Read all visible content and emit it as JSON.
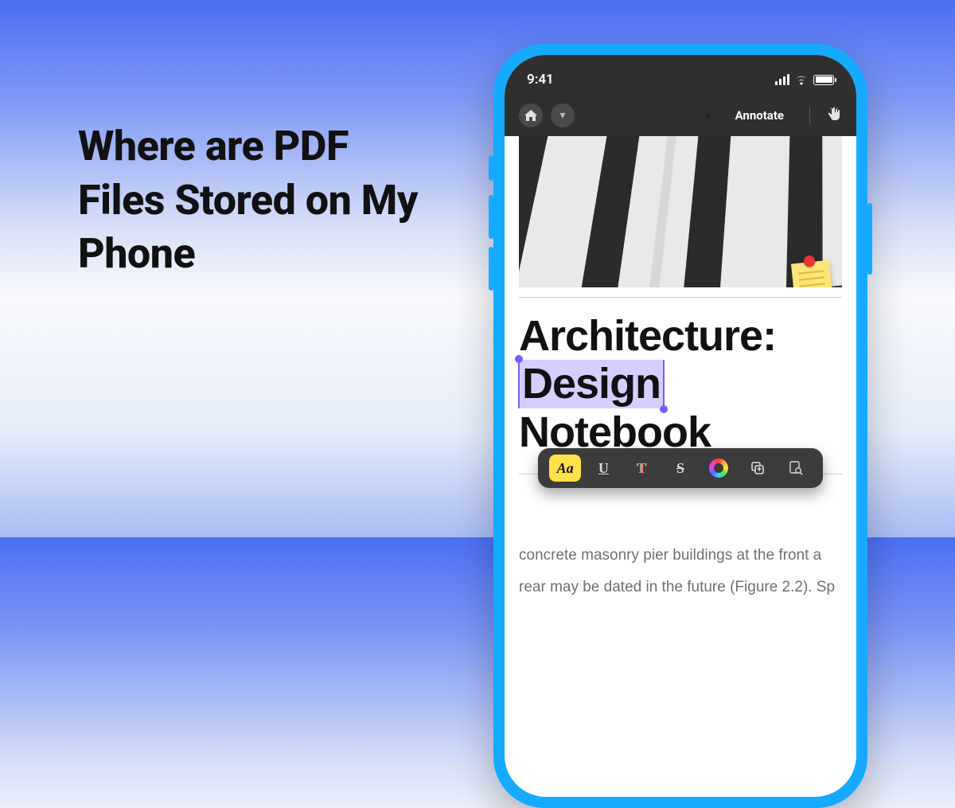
{
  "headline": "Where are PDF Files Stored on My Phone",
  "status": {
    "time": "9:41"
  },
  "nav": {
    "annotate_label": "Annotate"
  },
  "document": {
    "title_line1": "Architecture:",
    "title_word_selected": "Design",
    "title_word_rest": "Notebook",
    "body_line1": "concrete masonry pier buildings at the front a",
    "body_line2": "rear may be dated in the future (Figure 2.2). Sp"
  },
  "toolbar": {
    "highlight": "Aa",
    "underline": "U",
    "textcolor": "T",
    "strike": "S"
  }
}
